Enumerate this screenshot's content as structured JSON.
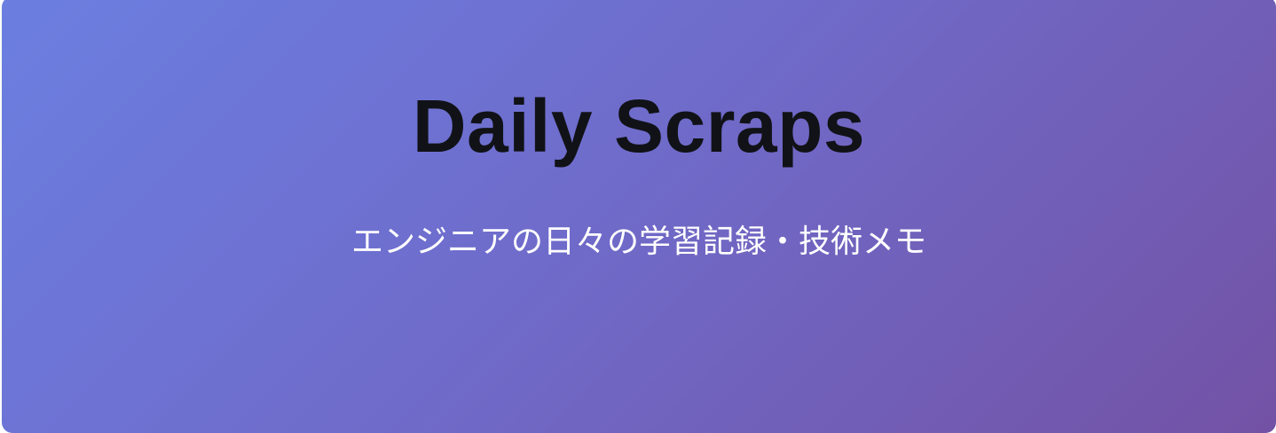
{
  "header": {
    "title": "Daily Scraps",
    "subtitle": "エンジニアの日々の学習記録・技術メモ"
  },
  "colors": {
    "gradient_start": "#6b7fe1",
    "gradient_end": "#7352a5",
    "title": "#111217",
    "subtitle": "#ffffff"
  }
}
